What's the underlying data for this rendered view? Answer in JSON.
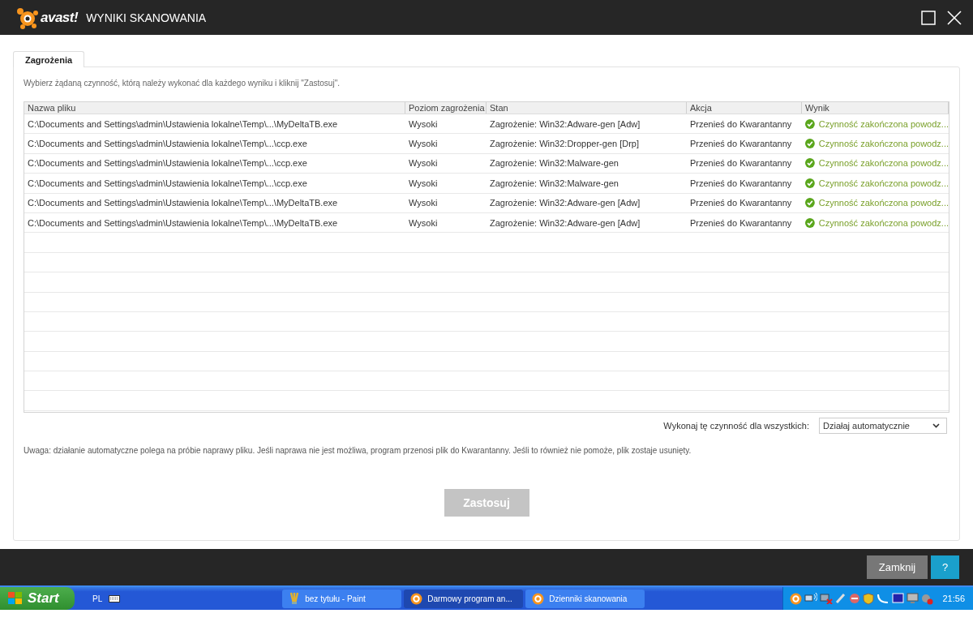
{
  "window": {
    "logo": "avast!",
    "title": "WYNIKI SKANOWANIA"
  },
  "tabs": [
    {
      "label": "Zagrożenia",
      "selected": true
    }
  ],
  "instruction": "Wybierz żądaną czynność, którą należy wykonać dla każdego wyniku i kliknij \"Zastosuj\".",
  "table": {
    "columns": [
      "Nazwa pliku",
      "Poziom zagrożenia",
      "Stan",
      "Akcja",
      "Wynik"
    ],
    "rows": [
      {
        "file": "C:\\Documents and Settings\\admin\\Ustawienia lokalne\\Temp\\...\\MyDeltaTB.exe",
        "level": "Wysoki",
        "status": "Zagrożenie: Win32:Adware-gen [Adw]",
        "action": "Przenieś do Kwarantanny",
        "result": "Czynność zakończona powodz...",
        "success": true
      },
      {
        "file": "C:\\Documents and Settings\\admin\\Ustawienia lokalne\\Temp\\...\\ccp.exe",
        "level": "Wysoki",
        "status": "Zagrożenie: Win32:Dropper-gen [Drp]",
        "action": "Przenieś do Kwarantanny",
        "result": "Czynność zakończona powodz...",
        "success": true
      },
      {
        "file": "C:\\Documents and Settings\\admin\\Ustawienia lokalne\\Temp\\...\\ccp.exe",
        "level": "Wysoki",
        "status": "Zagrożenie: Win32:Malware-gen",
        "action": "Przenieś do Kwarantanny",
        "result": "Czynność zakończona powodz...",
        "success": true
      },
      {
        "file": "C:\\Documents and Settings\\admin\\Ustawienia lokalne\\Temp\\...\\ccp.exe",
        "level": "Wysoki",
        "status": "Zagrożenie: Win32:Malware-gen",
        "action": "Przenieś do Kwarantanny",
        "result": "Czynność zakończona powodz...",
        "success": true
      },
      {
        "file": "C:\\Documents and Settings\\admin\\Ustawienia lokalne\\Temp\\...\\MyDeltaTB.exe",
        "level": "Wysoki",
        "status": "Zagrożenie: Win32:Adware-gen [Adw]",
        "action": "Przenieś do Kwarantanny",
        "result": "Czynność zakończona powodz...",
        "success": true
      },
      {
        "file": "C:\\Documents and Settings\\admin\\Ustawienia lokalne\\Temp\\...\\MyDeltaTB.exe",
        "level": "Wysoki",
        "status": "Zagrożenie: Win32:Adware-gen [Adw]",
        "action": "Przenieś do Kwarantanny",
        "result": "Czynność zakończona powodz...",
        "success": true
      }
    ]
  },
  "apply_all": {
    "label": "Wykonaj tę czynność dla wszystkich:",
    "value": "Działaj automatycznie"
  },
  "note": "Uwaga: działanie automatyczne polega na próbie naprawy pliku. Jeśli naprawa nie jest możliwa, program przenosi plik do Kwarantanny. Jeśli to również nie pomoże, plik zostaje usunięty.",
  "apply_button": {
    "label": "Zastosuj",
    "disabled": true
  },
  "footer_buttons": {
    "close": "Zamknij",
    "help": "?"
  },
  "taskbar": {
    "start": "Start",
    "language": "PL",
    "tasks": [
      {
        "label": "bez tytułu - Paint",
        "kind": "paint",
        "selected": false
      },
      {
        "label": "Darmowy program an...",
        "kind": "avast",
        "selected": true
      },
      {
        "label": "Dzienniki skanowania",
        "kind": "avast",
        "selected": false
      }
    ],
    "clock": "21:56"
  }
}
